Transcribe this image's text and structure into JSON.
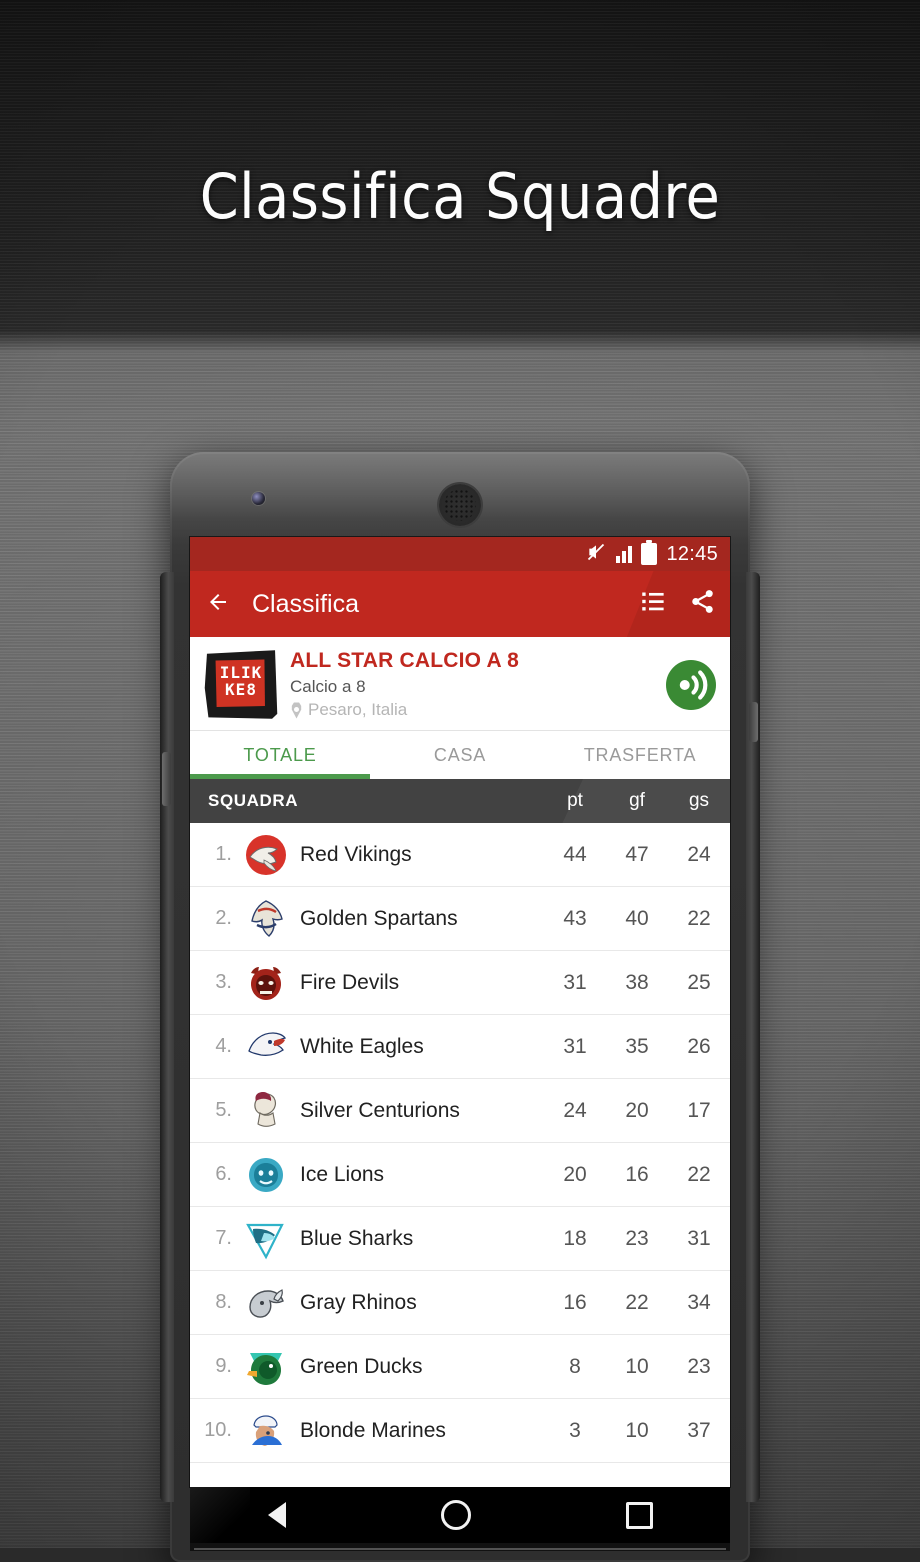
{
  "hero": {
    "title": "Classifica Squadre"
  },
  "statusbar": {
    "time": "12:45",
    "icons": [
      "mute-icon",
      "signal-icon",
      "battery-icon"
    ]
  },
  "appbar": {
    "back_icon": "back-arrow-icon",
    "title": "Classifica",
    "list_icon": "list-view-icon",
    "share_icon": "share-icon"
  },
  "league": {
    "logo_line1": "ILIK",
    "logo_line2": "KE8",
    "name": "ALL STAR CALCIO A 8",
    "sport": "Calcio a 8",
    "location": "Pesaro, Italia",
    "live_icon": "broadcast-icon",
    "accent": "#c0281f",
    "live_color": "#3a8a34"
  },
  "tabs": {
    "items": [
      {
        "label": "TOTALE",
        "active": true
      },
      {
        "label": "CASA",
        "active": false
      },
      {
        "label": "TRASFERTA",
        "active": false
      }
    ],
    "indicator_color": "#4c9a4c"
  },
  "table": {
    "headers": {
      "team": "SQUADRA",
      "pt": "pt",
      "gf": "gf",
      "gs": "gs"
    },
    "header_bg": "#424242",
    "rows": [
      {
        "pos": "1.",
        "team": "Red Vikings",
        "pt": "44",
        "gf": "47",
        "gs": "24",
        "crest": "viking-crest"
      },
      {
        "pos": "2.",
        "team": "Golden Spartans",
        "pt": "43",
        "gf": "40",
        "gs": "22",
        "crest": "spartan-crest"
      },
      {
        "pos": "3.",
        "team": "Fire Devils",
        "pt": "31",
        "gf": "38",
        "gs": "25",
        "crest": "devil-crest"
      },
      {
        "pos": "4.",
        "team": "White Eagles",
        "pt": "31",
        "gf": "35",
        "gs": "26",
        "crest": "eagle-crest"
      },
      {
        "pos": "5.",
        "team": "Silver Centurions",
        "pt": "24",
        "gf": "20",
        "gs": "17",
        "crest": "centurion-crest"
      },
      {
        "pos": "6.",
        "team": "Ice Lions",
        "pt": "20",
        "gf": "16",
        "gs": "22",
        "crest": "lion-crest"
      },
      {
        "pos": "7.",
        "team": "Blue Sharks",
        "pt": "18",
        "gf": "23",
        "gs": "31",
        "crest": "shark-crest"
      },
      {
        "pos": "8.",
        "team": "Gray Rhinos",
        "pt": "16",
        "gf": "22",
        "gs": "34",
        "crest": "rhino-crest"
      },
      {
        "pos": "9.",
        "team": "Green Ducks",
        "pt": "8",
        "gf": "10",
        "gs": "23",
        "crest": "duck-crest"
      },
      {
        "pos": "10.",
        "team": "Blonde Marines",
        "pt": "3",
        "gf": "10",
        "gs": "37",
        "crest": "marine-crest"
      }
    ]
  },
  "navbar": {
    "back": "nav-back-icon",
    "home": "nav-home-icon",
    "recents": "nav-recents-icon"
  }
}
